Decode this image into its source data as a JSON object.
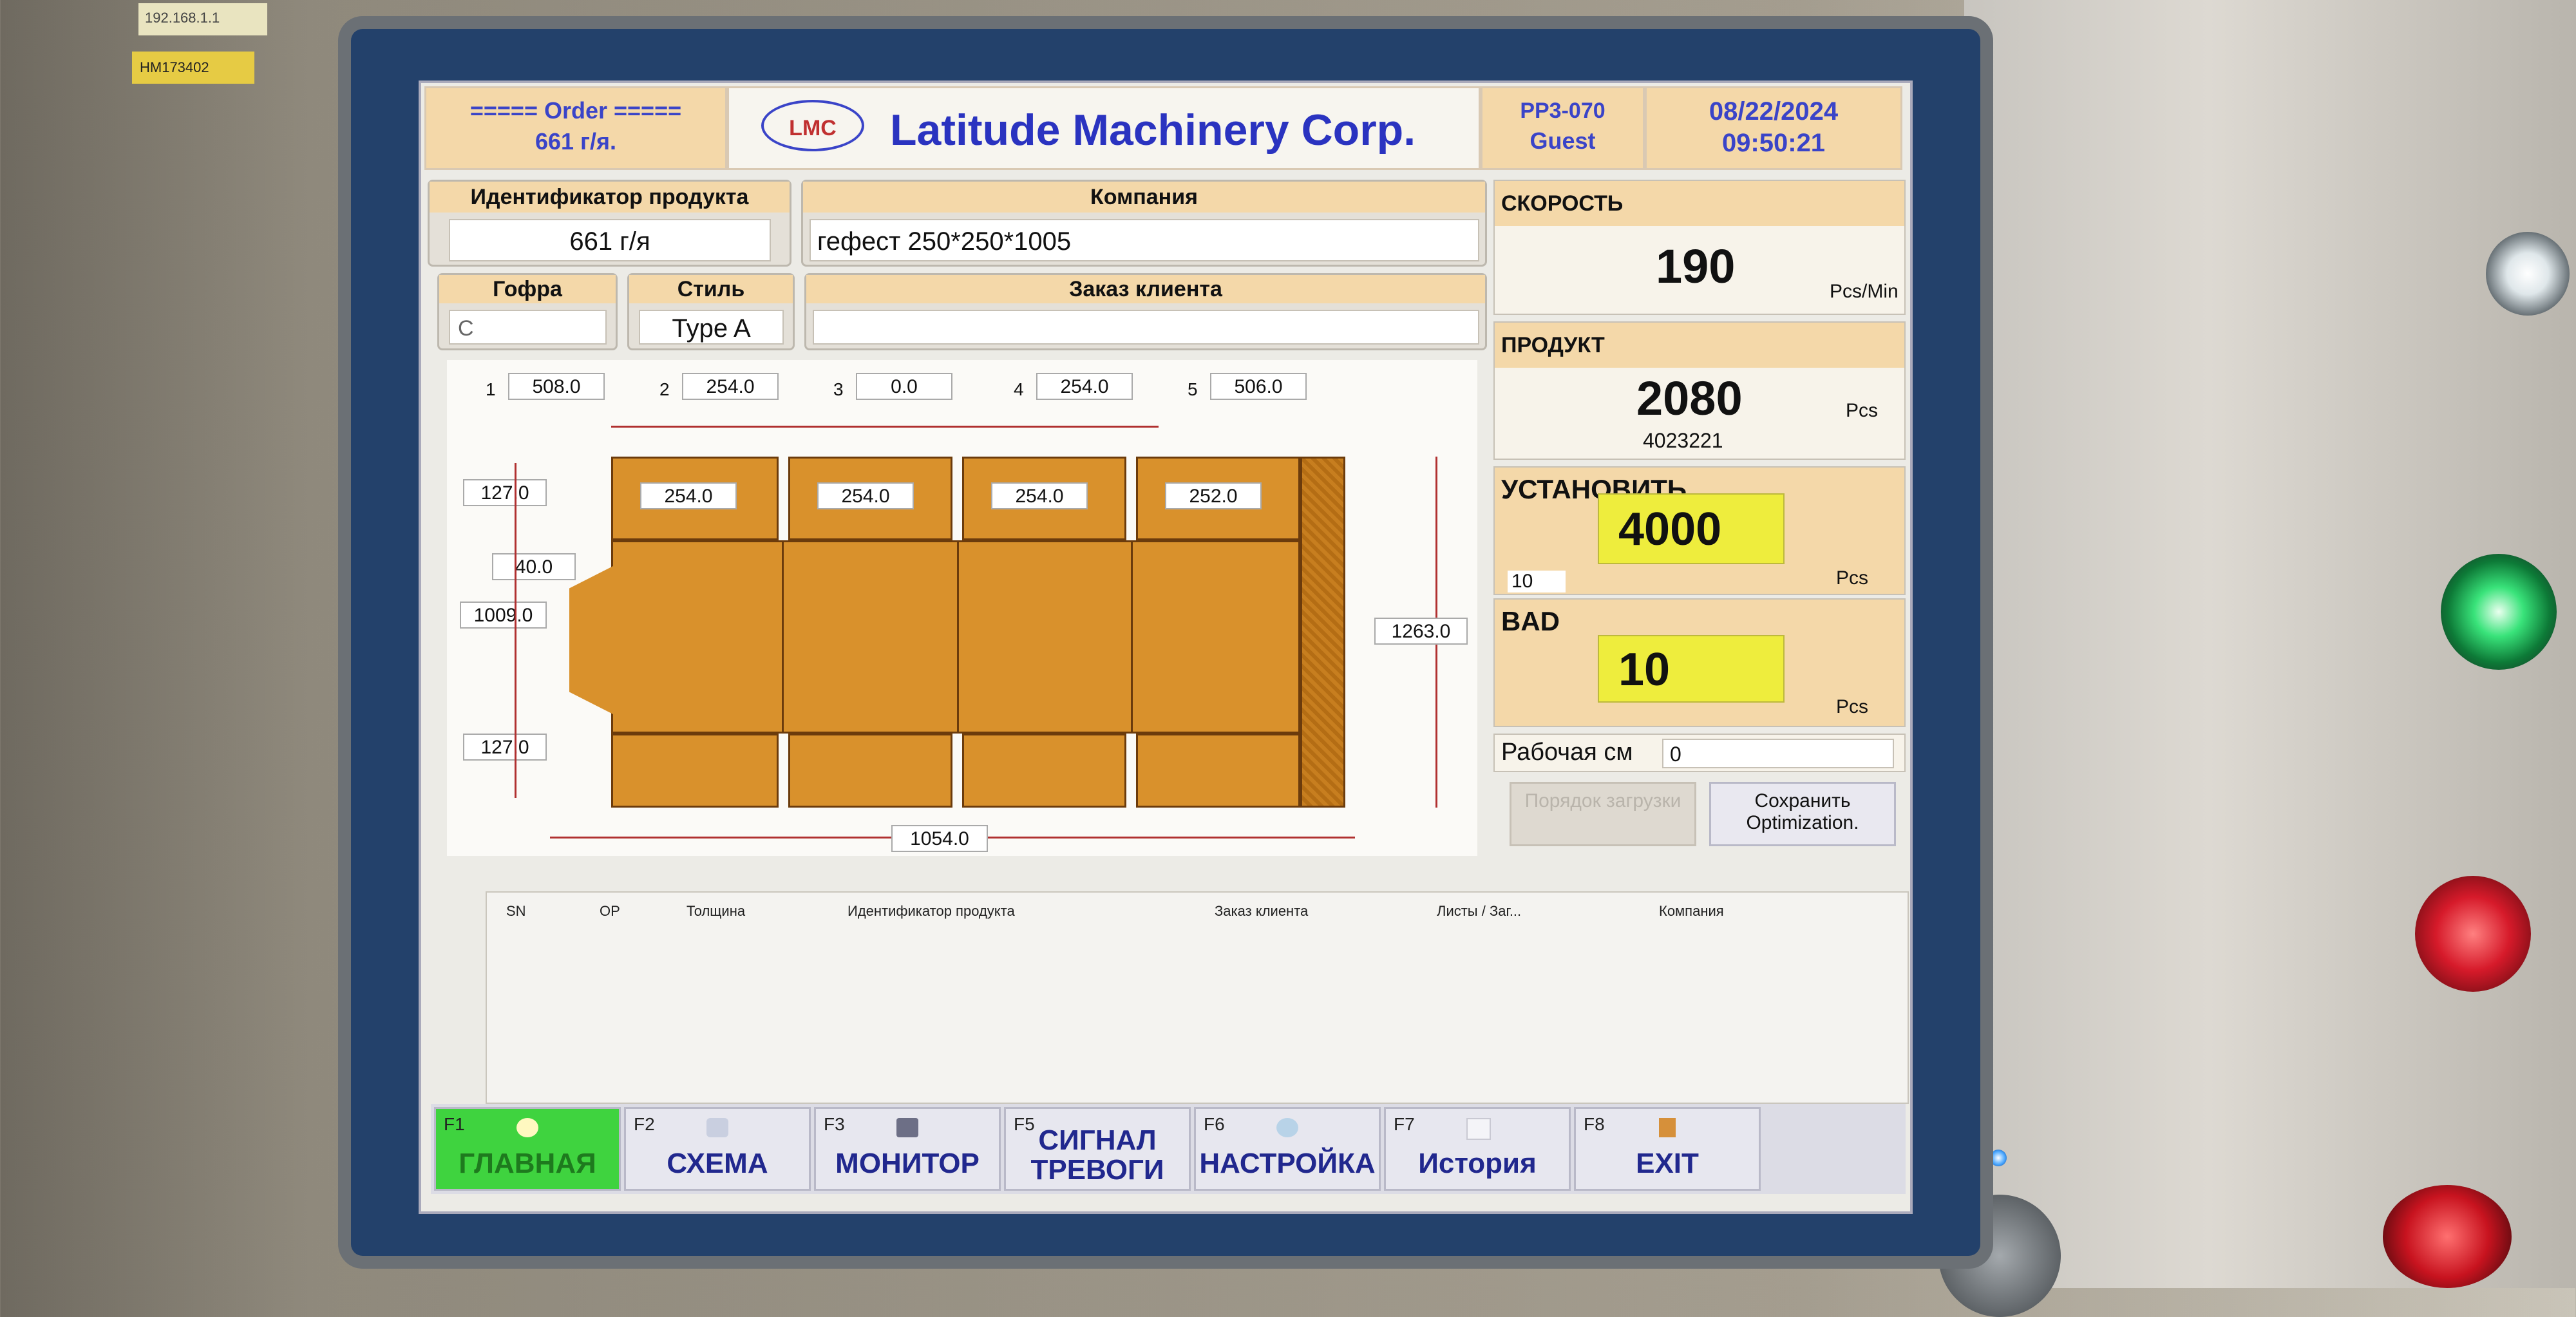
{
  "stickers": [
    "192.168.1.1",
    "HM173402"
  ],
  "header": {
    "order_title": "===== Order =====",
    "order_value": "661 г/я.",
    "logo_text": "LMC",
    "company_title": "Latitude Machinery Corp.",
    "machine_id": "PP3-070",
    "user": "Guest",
    "date": "08/22/2024",
    "time": "09:50:21"
  },
  "order_info": {
    "product_id_label": "Идентификатор продукта",
    "product_id_value": "661 г/я",
    "company_label": "Компания",
    "company_value": "гефест 250*250*1005",
    "flute_label": "Гофра",
    "flute_value": "C",
    "style_label": "Стиль",
    "style_value": "Type A",
    "customer_order_label": "Заказ клиента",
    "customer_order_value": ""
  },
  "diagram": {
    "top_index": [
      "1",
      "2",
      "3",
      "4",
      "5"
    ],
    "top_dims": [
      "508.0",
      "254.0",
      "0.0",
      "254.0",
      "506.0"
    ],
    "panel_dims": [
      "254.0",
      "254.0",
      "254.0",
      "252.0"
    ],
    "flap_top": "127.0",
    "glue_tab": "40.0",
    "body_height": "1009.0",
    "flap_bottom": "127.0",
    "total_height": "1263.0",
    "total_length": "1054.0"
  },
  "stats": {
    "speed_label": "СКОРОСТЬ",
    "speed_value": "190",
    "speed_unit": "Pcs/Min",
    "product_label": "ПРОДУКТ",
    "product_value": "2080",
    "product_unit": "Pcs",
    "product_sub": "4023221",
    "setpoint_label": "УСТАНОВИТЬ",
    "setpoint_value": "4000",
    "setpoint_small": "10",
    "setpoint_unit": "Pcs",
    "bad_label": "BAD",
    "bad_value": "10",
    "bad_unit": "Pcs",
    "shift_label": "Рабочая см",
    "shift_value": "0",
    "load_order_button": "Порядок загрузки",
    "save_optimization_button": "Сохранить Optimization."
  },
  "table": {
    "columns": [
      "SN",
      "OP",
      "Толщина",
      "Идентификатор продукта",
      "Заказ клиента",
      "Листы / Заг...",
      "Компания"
    ]
  },
  "fkeys": [
    {
      "key": "F1",
      "label": "ГЛАВНАЯ",
      "icon": "home-icon",
      "active": true
    },
    {
      "key": "F2",
      "label": "СХЕМА",
      "icon": "schema-icon"
    },
    {
      "key": "F3",
      "label": "МОНИТОР",
      "icon": "monitor-icon"
    },
    {
      "key": "F5",
      "label": "СИГНАЛ ТРЕВОГИ",
      "icon": "alarm-icon"
    },
    {
      "key": "F6",
      "label": "НАСТРОЙКА",
      "icon": "settings-icon"
    },
    {
      "key": "F7",
      "label": "История",
      "icon": "history-icon"
    },
    {
      "key": "F8",
      "label": "EXIT",
      "icon": "exit-icon"
    }
  ],
  "colors": {
    "header_bg": "#f4d8a9",
    "header_text": "#3a44c8",
    "box_fill": "#d9912c",
    "highlight_yellow": "#eeed3d",
    "active_key_green": "#3fd33f",
    "bezel": "#23416b"
  }
}
